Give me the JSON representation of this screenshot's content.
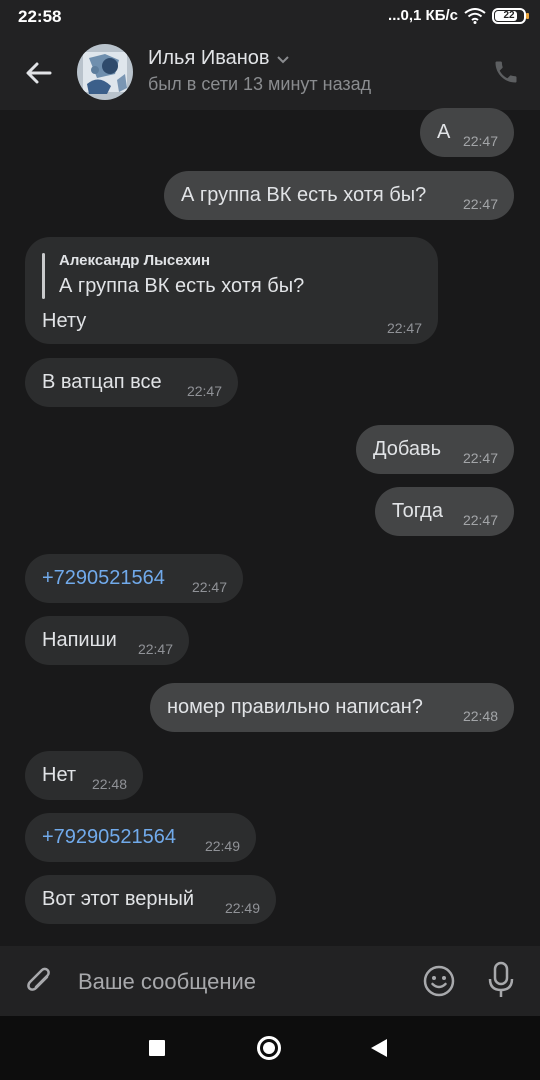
{
  "status_bar": {
    "time": "22:58",
    "network_speed": "...0,1 КБ/с",
    "battery_level": "22",
    "icons": [
      "wifi-icon",
      "battery-icon"
    ]
  },
  "header": {
    "contact_name": "Илья Иванов",
    "contact_status": "был в сети 13 минут назад",
    "icons": [
      "back-arrow-icon",
      "chevron-down-icon",
      "phone-icon"
    ]
  },
  "messages": [
    {
      "direction": "out",
      "text": "А",
      "time": "22:47"
    },
    {
      "direction": "out",
      "text": "А группа ВК есть хотя бы?",
      "time": "22:47"
    },
    {
      "direction": "in",
      "reply_author": "Александр Лысехин",
      "reply_text": "А группа ВК есть хотя бы?",
      "text": "Нету",
      "time": "22:47"
    },
    {
      "direction": "in",
      "text": "В ватцап все",
      "time": "22:47"
    },
    {
      "direction": "out",
      "text": "Добавь",
      "time": "22:47"
    },
    {
      "direction": "out",
      "text": "Тогда",
      "time": "22:47"
    },
    {
      "direction": "in",
      "text": "+7290521564",
      "time": "22:47",
      "is_link": true
    },
    {
      "direction": "in",
      "text": "Напиши",
      "time": "22:47"
    },
    {
      "direction": "out",
      "text": "номер правильно написан?",
      "time": "22:48"
    },
    {
      "direction": "in",
      "text": "Нет",
      "time": "22:48"
    },
    {
      "direction": "in",
      "text": "+79290521564",
      "time": "22:49",
      "is_link": true
    },
    {
      "direction": "in",
      "text": "Вот этот верный",
      "time": "22:49"
    }
  ],
  "composer": {
    "placeholder": "Ваше сообщение",
    "value": "",
    "icons": [
      "paperclip-icon",
      "emoji-icon",
      "microphone-icon"
    ]
  },
  "nav_bar": {
    "icons": [
      "recents-icon",
      "home-icon",
      "back-triangle-icon"
    ]
  },
  "colors": {
    "background": "#19191a",
    "header": "#222223",
    "incoming_bubble": "#2c2d2e",
    "outgoing_bubble": "#444546",
    "link": "#71aaeb",
    "text": "#e1e3e6",
    "secondary_text": "#8a8c8f"
  }
}
